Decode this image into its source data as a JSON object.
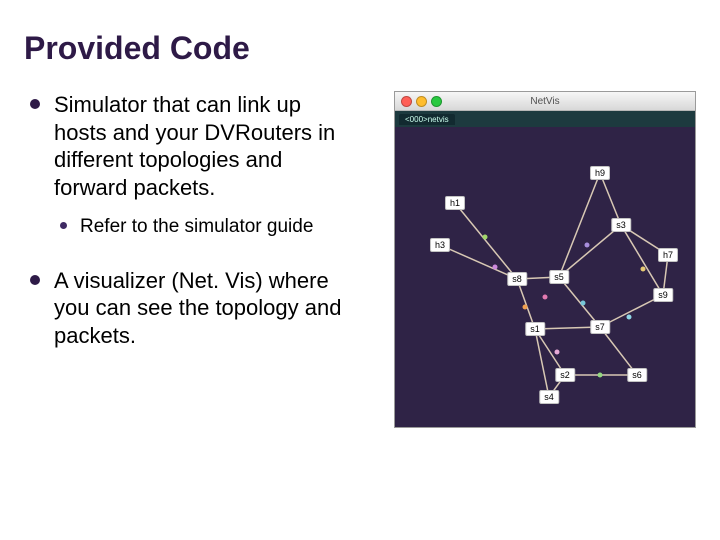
{
  "title": "Provided Code",
  "bullets": {
    "b1": "Simulator that can link up hosts and your DVRouters in different topologies and forward packets.",
    "b1_sub": "Refer to the simulator guide",
    "b2": "A visualizer (Net. Vis) where you can see the topology and packets."
  },
  "window": {
    "title": "NetVis",
    "tab": "<000>netvis"
  },
  "nodes": {
    "h9": "h9",
    "h1": "h1",
    "h3": "h3",
    "h7": "h7",
    "s8": "s8",
    "s5": "s5",
    "s3": "s3",
    "s9": "s9",
    "s1": "s1",
    "s7": "s7",
    "s2": "s2",
    "s4": "s4",
    "s6": "s6"
  }
}
